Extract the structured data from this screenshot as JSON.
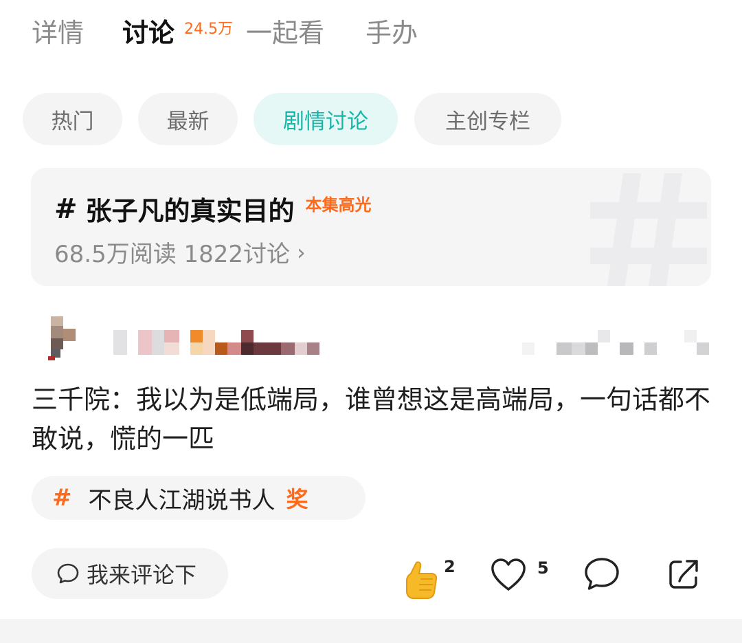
{
  "top_tabs": {
    "details": "详情",
    "discuss": "讨论",
    "discuss_count": "24.5万",
    "watch_together": "一起看",
    "figures": "手办"
  },
  "filter_chips": [
    {
      "label": "热门",
      "active": false
    },
    {
      "label": "最新",
      "active": false
    },
    {
      "label": "剧情讨论",
      "active": true
    },
    {
      "label": "主创专栏",
      "active": false
    }
  ],
  "topic": {
    "hash": "#",
    "title": "张子凡的真实目的",
    "badge": "本集高光",
    "stats": "68.5万阅读 1822讨论",
    "arrow": "›"
  },
  "comment": {
    "text": "三千院：我以为是低端局，谁曾想这是高端局，一句话都不敢说，慌的一匹",
    "tag_hash": "#",
    "tag_label": "不良人江湖说书人",
    "tag_award": "奖"
  },
  "actions": {
    "comment_input_placeholder": "我来评论下",
    "thumbs_count": "2",
    "like_count": "5"
  },
  "colors": {
    "accent_orange": "#ff6a1a",
    "accent_teal": "#17b5a8",
    "chip_bg": "#f4f4f5",
    "active_chip_bg": "#e6f8f6"
  },
  "icons": [
    "thumbs-up-icon",
    "heart-icon",
    "comment-bubble-icon",
    "share-icon",
    "chevron-right-icon",
    "hashtag-icon"
  ]
}
